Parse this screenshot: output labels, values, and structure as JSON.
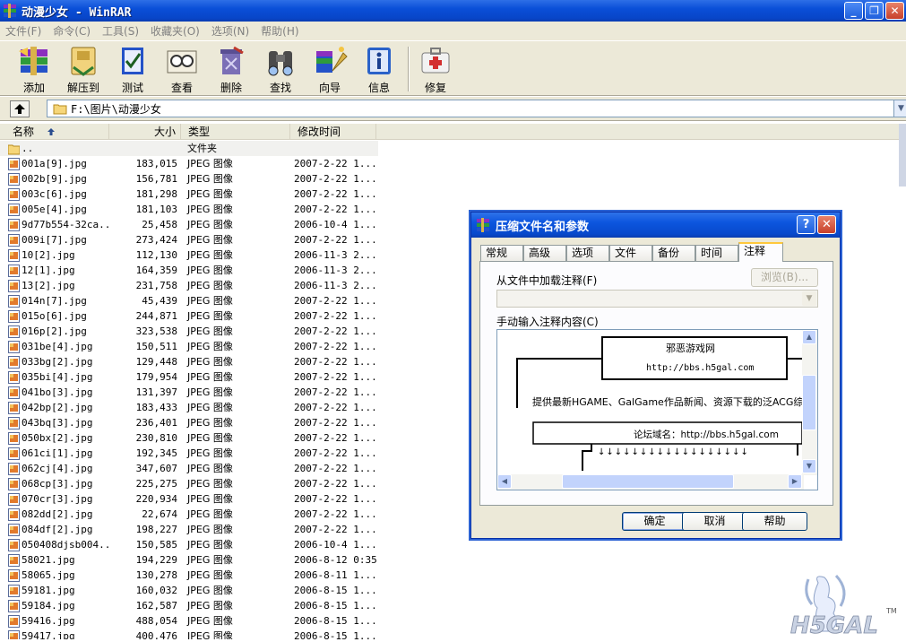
{
  "window": {
    "title": "动漫少女 - WinRAR",
    "min": "_",
    "max": "❐",
    "close": "✕"
  },
  "menu": [
    "文件(F)",
    "命令(C)",
    "工具(S)",
    "收藏夹(O)",
    "选项(N)",
    "帮助(H)"
  ],
  "toolbar": {
    "add": "添加",
    "extract": "解压到",
    "test": "测试",
    "view": "查看",
    "delete": "删除",
    "find": "查找",
    "wizard": "向导",
    "info": "信息",
    "repair": "修复"
  },
  "address": {
    "path": "F:\\图片\\动漫少女"
  },
  "columns": {
    "name": "名称",
    "size": "大小",
    "type": "类型",
    "modified": "修改时间"
  },
  "parent_row": {
    "name": "..",
    "type": "文件夹"
  },
  "files": [
    {
      "name": "001a[9].jpg",
      "size": "183,015",
      "type": "JPEG 图像",
      "modified": "2007-2-22 1..."
    },
    {
      "name": "002b[9].jpg",
      "size": "156,781",
      "type": "JPEG 图像",
      "modified": "2007-2-22 1..."
    },
    {
      "name": "003c[6].jpg",
      "size": "181,298",
      "type": "JPEG 图像",
      "modified": "2007-2-22 1..."
    },
    {
      "name": "005e[4].jpg",
      "size": "181,103",
      "type": "JPEG 图像",
      "modified": "2007-2-22 1..."
    },
    {
      "name": "9d77b554-32ca...",
      "size": "25,458",
      "type": "JPEG 图像",
      "modified": "2006-10-4 1..."
    },
    {
      "name": "009i[7].jpg",
      "size": "273,424",
      "type": "JPEG 图像",
      "modified": "2007-2-22 1..."
    },
    {
      "name": "10[2].jpg",
      "size": "112,130",
      "type": "JPEG 图像",
      "modified": "2006-11-3 2..."
    },
    {
      "name": "12[1].jpg",
      "size": "164,359",
      "type": "JPEG 图像",
      "modified": "2006-11-3 2..."
    },
    {
      "name": "13[2].jpg",
      "size": "231,758",
      "type": "JPEG 图像",
      "modified": "2006-11-3 2..."
    },
    {
      "name": "014n[7].jpg",
      "size": "45,439",
      "type": "JPEG 图像",
      "modified": "2007-2-22 1..."
    },
    {
      "name": "015o[6].jpg",
      "size": "244,871",
      "type": "JPEG 图像",
      "modified": "2007-2-22 1..."
    },
    {
      "name": "016p[2].jpg",
      "size": "323,538",
      "type": "JPEG 图像",
      "modified": "2007-2-22 1..."
    },
    {
      "name": "031be[4].jpg",
      "size": "150,511",
      "type": "JPEG 图像",
      "modified": "2007-2-22 1..."
    },
    {
      "name": "033bg[2].jpg",
      "size": "129,448",
      "type": "JPEG 图像",
      "modified": "2007-2-22 1..."
    },
    {
      "name": "035bi[4].jpg",
      "size": "179,954",
      "type": "JPEG 图像",
      "modified": "2007-2-22 1..."
    },
    {
      "name": "041bo[3].jpg",
      "size": "131,397",
      "type": "JPEG 图像",
      "modified": "2007-2-22 1..."
    },
    {
      "name": "042bp[2].jpg",
      "size": "183,433",
      "type": "JPEG 图像",
      "modified": "2007-2-22 1..."
    },
    {
      "name": "043bq[3].jpg",
      "size": "236,401",
      "type": "JPEG 图像",
      "modified": "2007-2-22 1..."
    },
    {
      "name": "050bx[2].jpg",
      "size": "230,810",
      "type": "JPEG 图像",
      "modified": "2007-2-22 1..."
    },
    {
      "name": "061ci[1].jpg",
      "size": "192,345",
      "type": "JPEG 图像",
      "modified": "2007-2-22 1..."
    },
    {
      "name": "062cj[4].jpg",
      "size": "347,607",
      "type": "JPEG 图像",
      "modified": "2007-2-22 1..."
    },
    {
      "name": "068cp[3].jpg",
      "size": "225,275",
      "type": "JPEG 图像",
      "modified": "2007-2-22 1..."
    },
    {
      "name": "070cr[3].jpg",
      "size": "220,934",
      "type": "JPEG 图像",
      "modified": "2007-2-22 1..."
    },
    {
      "name": "082dd[2].jpg",
      "size": "22,674",
      "type": "JPEG 图像",
      "modified": "2007-2-22 1..."
    },
    {
      "name": "084df[2].jpg",
      "size": "198,227",
      "type": "JPEG 图像",
      "modified": "2007-2-22 1..."
    },
    {
      "name": "050408djsb004...",
      "size": "150,585",
      "type": "JPEG 图像",
      "modified": "2006-10-4 1..."
    },
    {
      "name": "58021.jpg",
      "size": "194,229",
      "type": "JPEG 图像",
      "modified": "2006-8-12 0:35"
    },
    {
      "name": "58065.jpg",
      "size": "130,278",
      "type": "JPEG 图像",
      "modified": "2006-8-11 1..."
    },
    {
      "name": "59181.jpg",
      "size": "160,032",
      "type": "JPEG 图像",
      "modified": "2006-8-15 1..."
    },
    {
      "name": "59184.jpg",
      "size": "162,587",
      "type": "JPEG 图像",
      "modified": "2006-8-15 1..."
    },
    {
      "name": "59416.jpg",
      "size": "488,054",
      "type": "JPEG 图像",
      "modified": "2006-8-15 1..."
    },
    {
      "name": "59417.jpg",
      "size": "400,476",
      "type": "JPEG 图像",
      "modified": "2006-8-15 1..."
    }
  ],
  "dialog": {
    "title": "压缩文件名和参数",
    "help_btn": "?",
    "close_btn": "✕",
    "tabs": [
      "常规",
      "高级",
      "选项",
      "文件",
      "备份",
      "时间",
      "注释"
    ],
    "active_tab": "注释",
    "load_label": "从文件中加载注释(F)",
    "browse": "浏览(B)...",
    "manual_label": "手动输入注释内容(C)",
    "comment": {
      "site_name": "邪恶游戏网",
      "site_url": "http://bbs.h5gal.com",
      "desc": "提供最新HGAME、GalGame作品新闻、资源下载的泛ACG综合",
      "forum": "论坛域名：http://bbs.h5gal.com",
      "arrows": "↓↓↓↓↓↓↓↓↓↓↓↓↓↓↓↓↓↓"
    },
    "ok": "确定",
    "cancel": "取消",
    "help": "帮助"
  },
  "watermark": {
    "logo": "H5GAL",
    "tm": "TM"
  }
}
